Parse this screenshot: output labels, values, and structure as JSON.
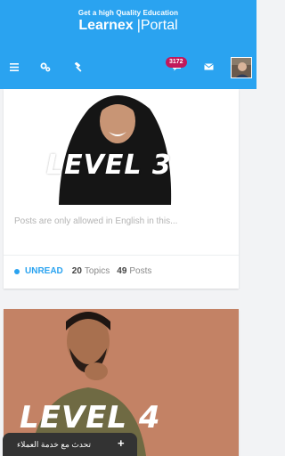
{
  "header": {
    "tagline": "Get a high Quality Education",
    "logo_main": "Learnex",
    "logo_sep": "|",
    "logo_sub": "Portal",
    "notification_count": "3172",
    "colors": {
      "bar": "#2aa3f0",
      "badge": "#c2185b"
    }
  },
  "toolbar": {
    "icons": [
      "menu-icon",
      "cogs-icon",
      "hammer-icon",
      "chat-bubble-icon",
      "envelope-icon",
      "user-avatar"
    ]
  },
  "cards": [
    {
      "image_text": "LEVEL 3",
      "image_faint_text": "LEVEL",
      "excerpt": "Posts are only allowed in English in this...",
      "status": "UNREAD",
      "topics_count": "20",
      "topics_label": "Topics",
      "posts_count": "49",
      "posts_label": "Posts"
    },
    {
      "image_text": "LEVEL 4"
    }
  ],
  "chat": {
    "label": "تحدث مع خدمة العملاء",
    "plus": "+"
  }
}
